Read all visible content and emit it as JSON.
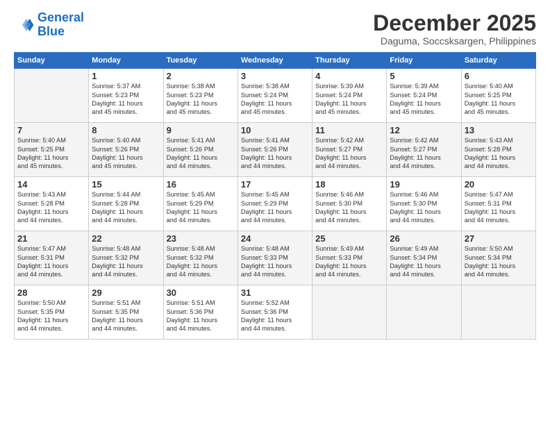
{
  "logo": {
    "line1": "General",
    "line2": "Blue"
  },
  "title": "December 2025",
  "subtitle": "Daguma, Soccsksargen, Philippines",
  "days_header": [
    "Sunday",
    "Monday",
    "Tuesday",
    "Wednesday",
    "Thursday",
    "Friday",
    "Saturday"
  ],
  "weeks": [
    [
      {
        "num": "",
        "info": ""
      },
      {
        "num": "1",
        "info": "Sunrise: 5:37 AM\nSunset: 5:23 PM\nDaylight: 11 hours\nand 45 minutes."
      },
      {
        "num": "2",
        "info": "Sunrise: 5:38 AM\nSunset: 5:23 PM\nDaylight: 11 hours\nand 45 minutes."
      },
      {
        "num": "3",
        "info": "Sunrise: 5:38 AM\nSunset: 5:24 PM\nDaylight: 11 hours\nand 45 minutes."
      },
      {
        "num": "4",
        "info": "Sunrise: 5:39 AM\nSunset: 5:24 PM\nDaylight: 11 hours\nand 45 minutes."
      },
      {
        "num": "5",
        "info": "Sunrise: 5:39 AM\nSunset: 5:24 PM\nDaylight: 11 hours\nand 45 minutes."
      },
      {
        "num": "6",
        "info": "Sunrise: 5:40 AM\nSunset: 5:25 PM\nDaylight: 11 hours\nand 45 minutes."
      }
    ],
    [
      {
        "num": "7",
        "info": "Sunrise: 5:40 AM\nSunset: 5:25 PM\nDaylight: 11 hours\nand 45 minutes."
      },
      {
        "num": "8",
        "info": "Sunrise: 5:40 AM\nSunset: 5:26 PM\nDaylight: 11 hours\nand 45 minutes."
      },
      {
        "num": "9",
        "info": "Sunrise: 5:41 AM\nSunset: 5:26 PM\nDaylight: 11 hours\nand 44 minutes."
      },
      {
        "num": "10",
        "info": "Sunrise: 5:41 AM\nSunset: 5:26 PM\nDaylight: 11 hours\nand 44 minutes."
      },
      {
        "num": "11",
        "info": "Sunrise: 5:42 AM\nSunset: 5:27 PM\nDaylight: 11 hours\nand 44 minutes."
      },
      {
        "num": "12",
        "info": "Sunrise: 5:42 AM\nSunset: 5:27 PM\nDaylight: 11 hours\nand 44 minutes."
      },
      {
        "num": "13",
        "info": "Sunrise: 5:43 AM\nSunset: 5:28 PM\nDaylight: 11 hours\nand 44 minutes."
      }
    ],
    [
      {
        "num": "14",
        "info": "Sunrise: 5:43 AM\nSunset: 5:28 PM\nDaylight: 11 hours\nand 44 minutes."
      },
      {
        "num": "15",
        "info": "Sunrise: 5:44 AM\nSunset: 5:28 PM\nDaylight: 11 hours\nand 44 minutes."
      },
      {
        "num": "16",
        "info": "Sunrise: 5:45 AM\nSunset: 5:29 PM\nDaylight: 11 hours\nand 44 minutes."
      },
      {
        "num": "17",
        "info": "Sunrise: 5:45 AM\nSunset: 5:29 PM\nDaylight: 11 hours\nand 44 minutes."
      },
      {
        "num": "18",
        "info": "Sunrise: 5:46 AM\nSunset: 5:30 PM\nDaylight: 11 hours\nand 44 minutes."
      },
      {
        "num": "19",
        "info": "Sunrise: 5:46 AM\nSunset: 5:30 PM\nDaylight: 11 hours\nand 44 minutes."
      },
      {
        "num": "20",
        "info": "Sunrise: 5:47 AM\nSunset: 5:31 PM\nDaylight: 11 hours\nand 44 minutes."
      }
    ],
    [
      {
        "num": "21",
        "info": "Sunrise: 5:47 AM\nSunset: 5:31 PM\nDaylight: 11 hours\nand 44 minutes."
      },
      {
        "num": "22",
        "info": "Sunrise: 5:48 AM\nSunset: 5:32 PM\nDaylight: 11 hours\nand 44 minutes."
      },
      {
        "num": "23",
        "info": "Sunrise: 5:48 AM\nSunset: 5:32 PM\nDaylight: 11 hours\nand 44 minutes."
      },
      {
        "num": "24",
        "info": "Sunrise: 5:48 AM\nSunset: 5:33 PM\nDaylight: 11 hours\nand 44 minutes."
      },
      {
        "num": "25",
        "info": "Sunrise: 5:49 AM\nSunset: 5:33 PM\nDaylight: 11 hours\nand 44 minutes."
      },
      {
        "num": "26",
        "info": "Sunrise: 5:49 AM\nSunset: 5:34 PM\nDaylight: 11 hours\nand 44 minutes."
      },
      {
        "num": "27",
        "info": "Sunrise: 5:50 AM\nSunset: 5:34 PM\nDaylight: 11 hours\nand 44 minutes."
      }
    ],
    [
      {
        "num": "28",
        "info": "Sunrise: 5:50 AM\nSunset: 5:35 PM\nDaylight: 11 hours\nand 44 minutes."
      },
      {
        "num": "29",
        "info": "Sunrise: 5:51 AM\nSunset: 5:35 PM\nDaylight: 11 hours\nand 44 minutes."
      },
      {
        "num": "30",
        "info": "Sunrise: 5:51 AM\nSunset: 5:36 PM\nDaylight: 11 hours\nand 44 minutes."
      },
      {
        "num": "31",
        "info": "Sunrise: 5:52 AM\nSunset: 5:36 PM\nDaylight: 11 hours\nand 44 minutes."
      },
      {
        "num": "",
        "info": ""
      },
      {
        "num": "",
        "info": ""
      },
      {
        "num": "",
        "info": ""
      }
    ]
  ]
}
